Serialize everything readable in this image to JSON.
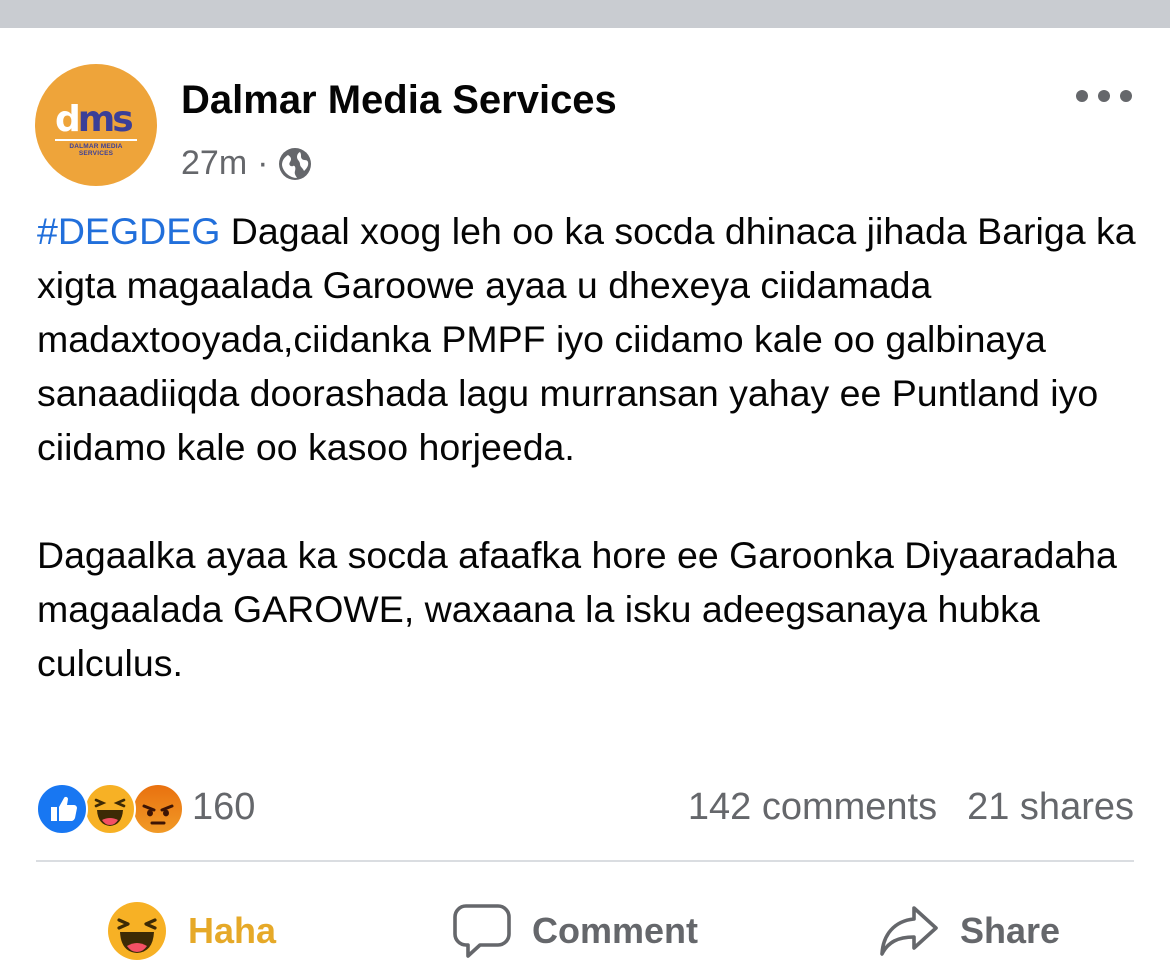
{
  "post": {
    "page_name": "Dalmar Media Services",
    "time": "27m",
    "separator": "·",
    "audience_icon": "globe-icon",
    "avatar": {
      "logo_letters": [
        "d",
        "m",
        "s"
      ],
      "logo_caption": "DALMAR MEDIA SERVICES",
      "background": "#eea43a",
      "accent": "#3b3f98"
    },
    "hashtag": "#DEGDEG",
    "paragraph_1_rest": " Dagaal xoog leh oo ka socda dhinaca jihada Bariga ka xigta magaalada Garoowe ayaa u dhexeya ciidamada madaxtooyada,ciidanka PMPF iyo ciidamo kale oo galbinaya sanaadiiqda doorashada lagu murransan yahay ee Puntland iyo ciidamo kale oo kasoo horjeeda.",
    "paragraph_2": "Dagaalka ayaa ka socda afaafka hore ee Garoonka Diyaaradaha magaalada GAROWE, waxaana la isku adeegsanaya hubka culculus."
  },
  "engagement": {
    "reaction_icons": [
      "like-icon",
      "haha-icon",
      "angry-icon"
    ],
    "reaction_count": "160",
    "comments": "142 comments",
    "shares": "21 shares"
  },
  "actions": {
    "haha_label": "Haha",
    "comment_label": "Comment",
    "share_label": "Share"
  },
  "colors": {
    "hashtag": "#216fdb",
    "haha_active": "#e6a928",
    "secondary_text": "#65676b",
    "like_blue": "#1877f2"
  }
}
